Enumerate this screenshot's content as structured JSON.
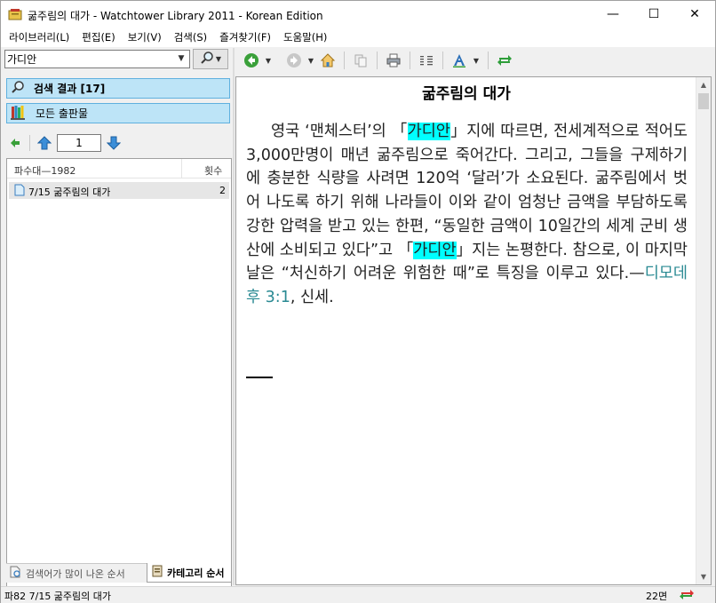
{
  "window": {
    "title": "굶주림의 대가 - Watchtower Library 2011 - Korean Edition",
    "minimize": "—",
    "maximize": "☐",
    "close": "✕"
  },
  "menu": [
    "라이브러리(L)",
    "편집(E)",
    "보기(V)",
    "검색(S)",
    "즐겨찾기(F)",
    "도움말(H)"
  ],
  "search": {
    "value": "가디안"
  },
  "nav": {
    "results_label": "검색 결과 [17]",
    "publications_label": "모든 출판물"
  },
  "pager": {
    "page": "1"
  },
  "results": {
    "header_title": "파수대—1982",
    "header_count": "횟수",
    "rows": [
      {
        "title": "7/15 굶주림의 대가",
        "count": "2"
      }
    ]
  },
  "bottom_tabs": {
    "tab1": "검색어가 많이 나온 순서",
    "tab2": "카테고리 순서"
  },
  "article": {
    "title": "굶주림의 대가",
    "p1": "영국 ‘맨체스터’의 「",
    "h1": "가디안",
    "p2": "」지에 따르면, 전세계적으로 적어도 3,000만명이 매년 굶주림으로 죽어간다. 그리고, 그들을 구제하기에 충분한 식량을 사려면 120억 ‘달러’가 소요된다. 굶주림에서 벗어 나도록 하기 위해 나라들이 이와 같이 엄청난 금액을 부담하도록 강한 압력을 받고 있는 한편, “동일한 금액이 10일간의 세계 군비 생산에 소비되고 있다”고 「",
    "h2": "가디안",
    "p3": "」지는 논평한다. 참으로, 이 마지막 날은 “처신하기 어려운 위험한 때”로 특징을 이루고 있다.—",
    "ref": "디모데 후 3:1",
    "p4": ", 신세."
  },
  "status": {
    "location": "파82 7/15 굶주림의 대가",
    "page": "22면"
  },
  "colors": {
    "highlight": "#00ffff",
    "reference_link": "#2a8a93",
    "nav_selected": "#bde4f7"
  }
}
